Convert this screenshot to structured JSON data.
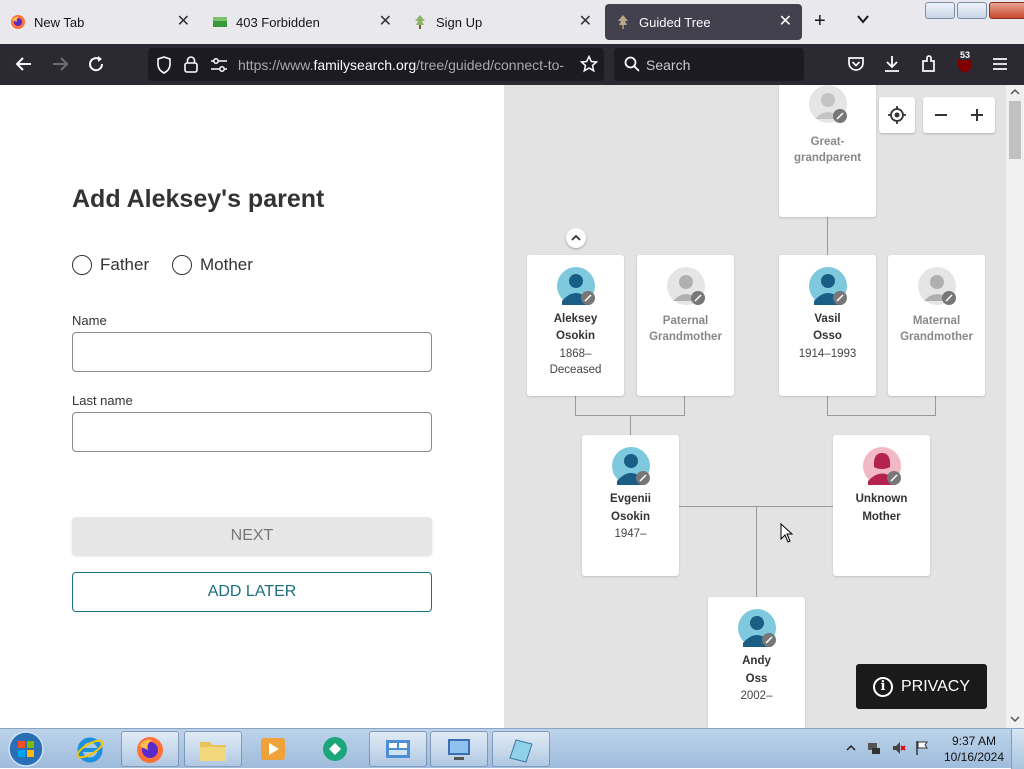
{
  "browser": {
    "tabs": [
      {
        "title": "New Tab",
        "icon": "firefox-icon"
      },
      {
        "title": "403 Forbidden",
        "icon": "image-icon"
      },
      {
        "title": "Sign Up",
        "icon": "tree-icon"
      },
      {
        "title": "Guided Tree",
        "icon": "tree-icon",
        "active": true
      }
    ],
    "url_prefix": "https://www.",
    "url_domain": "familysearch.org",
    "url_path": "/tree/guided/connect-to-",
    "search_placeholder": "Search",
    "extension_badge": "53"
  },
  "form": {
    "heading": "Add Aleksey's parent",
    "radio_father": "Father",
    "radio_mother": "Mother",
    "name_label": "Name",
    "name_value": "",
    "lastname_label": "Last name",
    "lastname_value": "",
    "next_label": "NEXT",
    "later_label": "ADD LATER"
  },
  "tree": {
    "great_grandparent": {
      "name1": "Great-",
      "name2": "grandparent"
    },
    "aleksey": {
      "first": "Aleksey",
      "last": "Osokin",
      "dates1": "1868–",
      "dates2": "Deceased"
    },
    "paternal_gm": {
      "line1": "Paternal",
      "line2": "Grandmother"
    },
    "vasil": {
      "first": "Vasil",
      "last": "Osso",
      "dates": "1914–1993"
    },
    "maternal_gm": {
      "line1": "Maternal",
      "line2": "Grandmother"
    },
    "evgenii": {
      "first": "Evgenii",
      "last": "Osokin",
      "dates": "1947–"
    },
    "unknown_mother": {
      "line1": "Unknown",
      "line2": "Mother"
    },
    "andy": {
      "first": "Andy",
      "last": "Oss",
      "dates": "2002–"
    },
    "privacy_label": "PRIVACY"
  },
  "taskbar": {
    "time": "9:37 AM",
    "date": "10/16/2024"
  },
  "colors": {
    "male": "#1a5e86",
    "female": "#b3234f",
    "unknown": "#9a9a9a",
    "accent": "#1a6e7f"
  }
}
